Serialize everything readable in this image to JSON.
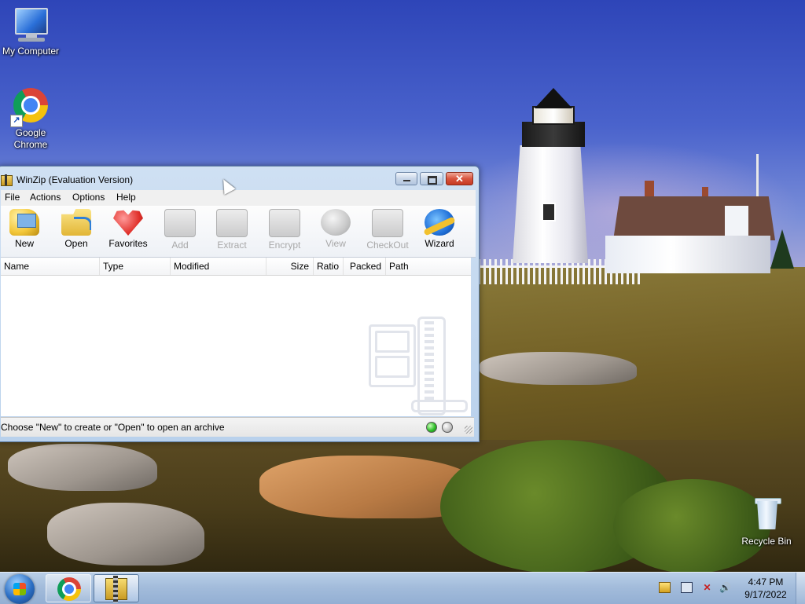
{
  "desktop": {
    "icons": [
      {
        "label": "My Computer"
      },
      {
        "label": "Google Chrome"
      },
      {
        "label": "Recycle Bin"
      }
    ]
  },
  "window": {
    "title": "WinZip (Evaluation Version)",
    "menu": [
      "File",
      "Actions",
      "Options",
      "Help"
    ],
    "toolbar": [
      {
        "label": "New",
        "enabled": true
      },
      {
        "label": "Open",
        "enabled": true
      },
      {
        "label": "Favorites",
        "enabled": true
      },
      {
        "label": "Add",
        "enabled": false
      },
      {
        "label": "Extract",
        "enabled": false
      },
      {
        "label": "Encrypt",
        "enabled": false
      },
      {
        "label": "View",
        "enabled": false
      },
      {
        "label": "CheckOut",
        "enabled": false
      },
      {
        "label": "Wizard",
        "enabled": true
      }
    ],
    "columns": [
      "Name",
      "Type",
      "Modified",
      "Size",
      "Ratio",
      "Packed",
      "Path"
    ],
    "rows": [],
    "status": "Choose \"New\" to create or \"Open\" to open an archive",
    "close_glyph": "✕"
  },
  "taskbar": {
    "apps": [
      "Google Chrome",
      "WinZip"
    ],
    "clock": {
      "time": "4:47 PM",
      "date": "9/17/2022"
    },
    "tray_icons": [
      "action-center-icon",
      "network-icon",
      "power-icon",
      "volume-icon"
    ],
    "volume_glyph": "🔊",
    "power_glyph": "✕"
  }
}
